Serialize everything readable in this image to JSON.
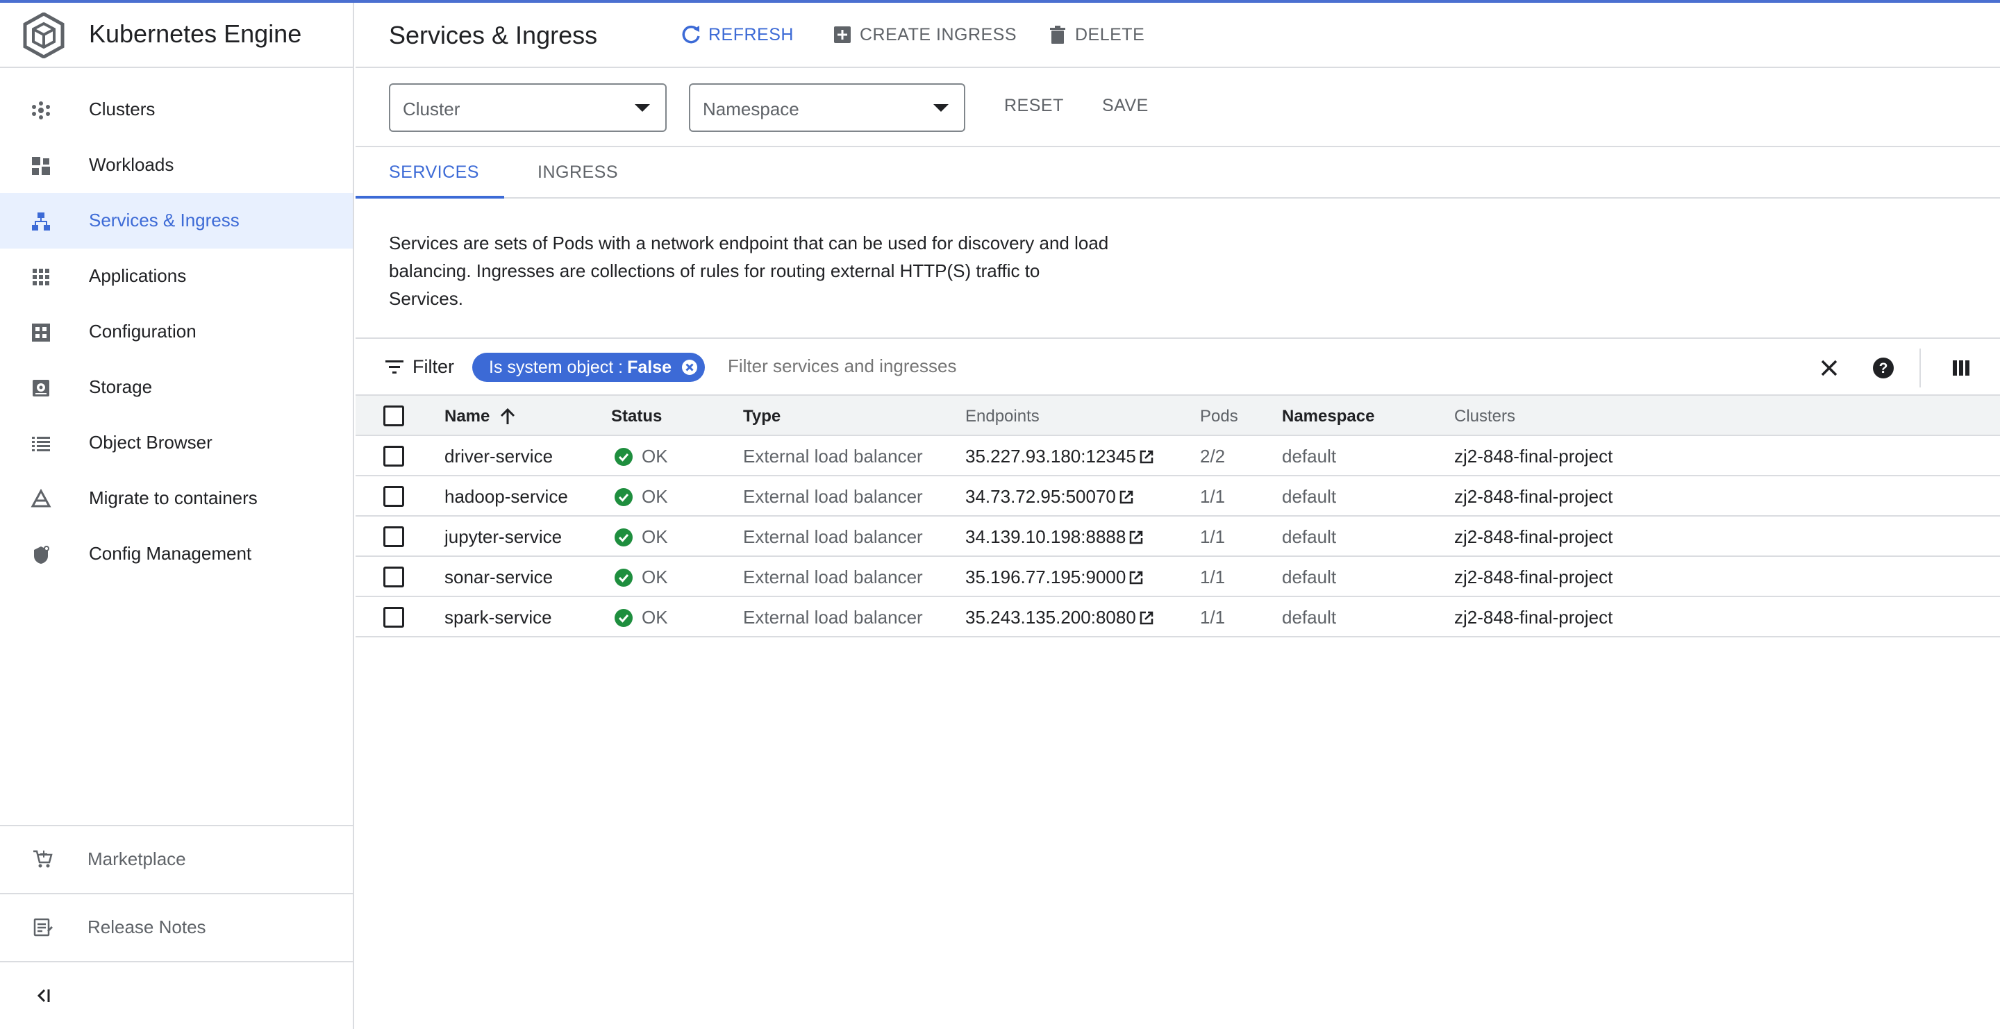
{
  "app": {
    "title": "Kubernetes Engine"
  },
  "sidebar": {
    "items": [
      {
        "label": "Clusters",
        "icon": "clusters-icon"
      },
      {
        "label": "Workloads",
        "icon": "workloads-icon"
      },
      {
        "label": "Services & Ingress",
        "icon": "services-icon",
        "active": true
      },
      {
        "label": "Applications",
        "icon": "applications-icon"
      },
      {
        "label": "Configuration",
        "icon": "configuration-icon"
      },
      {
        "label": "Storage",
        "icon": "storage-icon"
      },
      {
        "label": "Object Browser",
        "icon": "object-browser-icon"
      },
      {
        "label": "Migrate to containers",
        "icon": "migrate-icon"
      },
      {
        "label": "Config Management",
        "icon": "config-management-icon"
      }
    ],
    "footer": [
      {
        "label": "Marketplace",
        "icon": "cart-icon"
      },
      {
        "label": "Release Notes",
        "icon": "release-notes-icon"
      }
    ]
  },
  "header": {
    "title": "Services & Ingress",
    "refresh": "REFRESH",
    "create_ingress": "CREATE INGRESS",
    "delete": "DELETE"
  },
  "filters": {
    "cluster_placeholder": "Cluster",
    "namespace_placeholder": "Namespace",
    "reset": "RESET",
    "save": "SAVE"
  },
  "tabs": [
    {
      "label": "SERVICES",
      "active": true
    },
    {
      "label": "INGRESS",
      "active": false
    }
  ],
  "description": "Services are sets of Pods with a network endpoint that can be used for discovery and load balancing. Ingresses are collections of rules for routing external HTTP(S) traffic to Services.",
  "filterbar": {
    "label": "Filter",
    "chip_key": "Is system object :",
    "chip_value": "False",
    "search_placeholder": "Filter services and ingresses"
  },
  "table": {
    "columns": [
      "Name",
      "Status",
      "Type",
      "Endpoints",
      "Pods",
      "Namespace",
      "Clusters"
    ],
    "sort_column": "Name",
    "rows": [
      {
        "name": "driver-service",
        "status": "OK",
        "type": "External load balancer",
        "endpoint": "35.227.93.180:12345",
        "pods": "2/2",
        "namespace": "default",
        "cluster": "zj2-848-final-project"
      },
      {
        "name": "hadoop-service",
        "status": "OK",
        "type": "External load balancer",
        "endpoint": "34.73.72.95:50070",
        "pods": "1/1",
        "namespace": "default",
        "cluster": "zj2-848-final-project"
      },
      {
        "name": "jupyter-service",
        "status": "OK",
        "type": "External load balancer",
        "endpoint": "34.139.10.198:8888",
        "pods": "1/1",
        "namespace": "default",
        "cluster": "zj2-848-final-project"
      },
      {
        "name": "sonar-service",
        "status": "OK",
        "type": "External load balancer",
        "endpoint": "35.196.77.195:9000",
        "pods": "1/1",
        "namespace": "default",
        "cluster": "zj2-848-final-project"
      },
      {
        "name": "spark-service",
        "status": "OK",
        "type": "External load balancer",
        "endpoint": "35.243.135.200:8080",
        "pods": "1/1",
        "namespace": "default",
        "cluster": "zj2-848-final-project"
      }
    ]
  },
  "colors": {
    "accent": "#3c6ad6",
    "ok": "#1e8e3e",
    "active_bg": "#e8f0fe"
  }
}
